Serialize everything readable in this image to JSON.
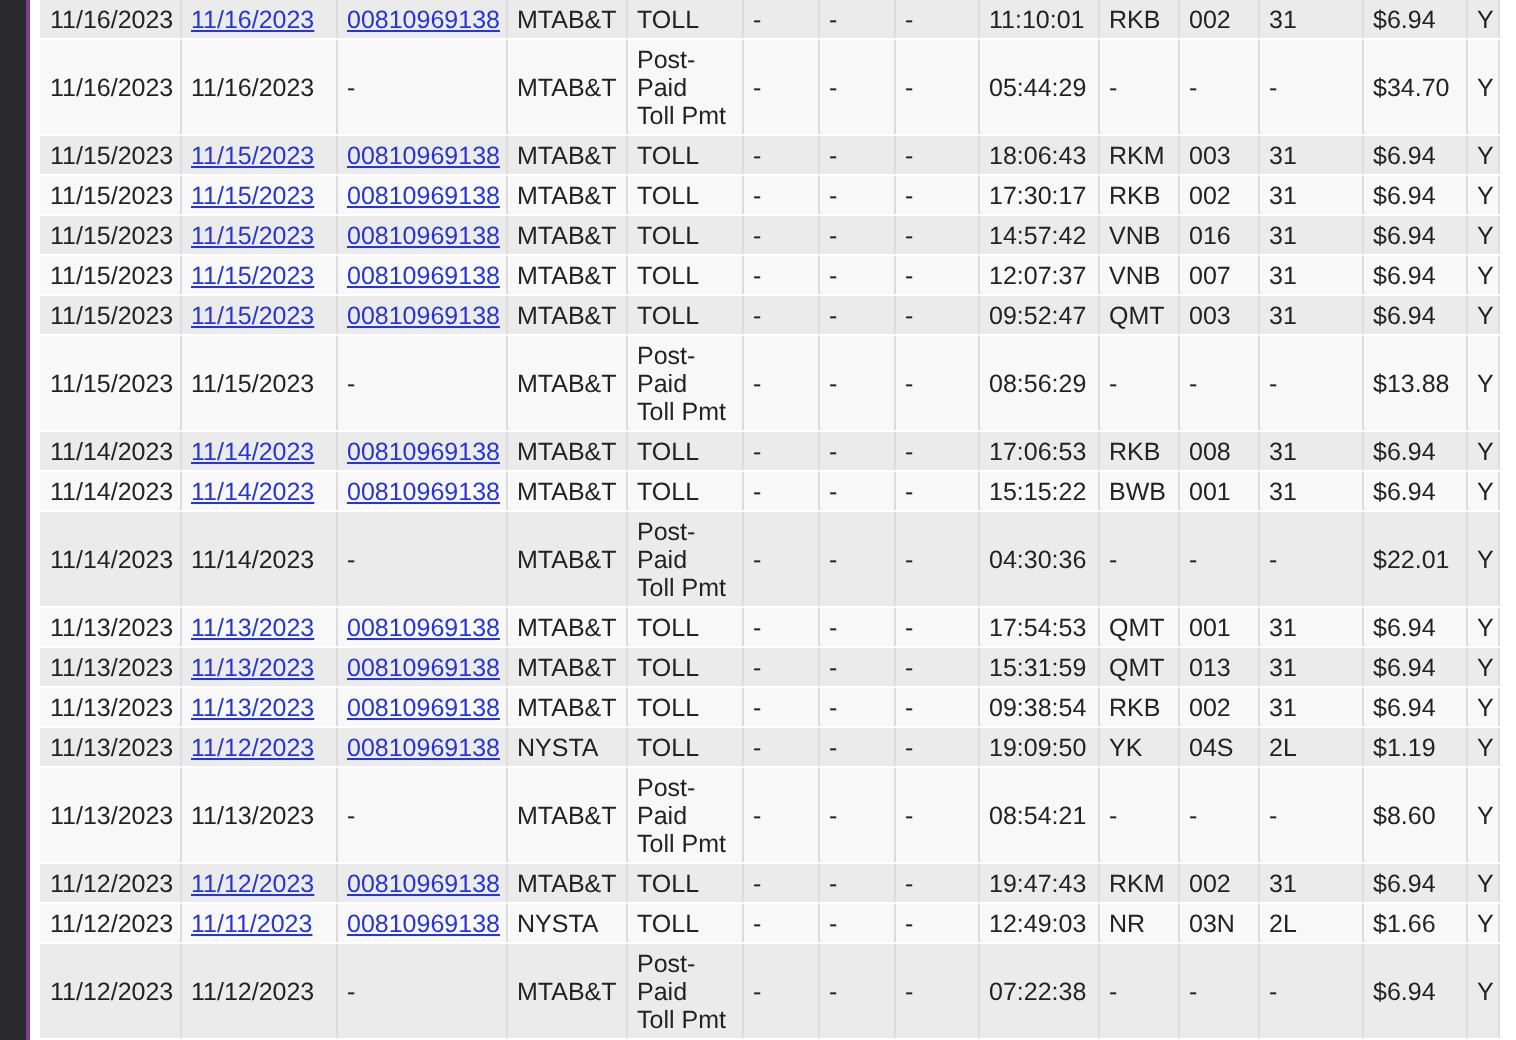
{
  "table": {
    "rows": [
      {
        "kind": "toll",
        "cells": [
          "11/16/2023",
          "11/16/2023",
          "00810969138",
          "MTAB&T",
          "TOLL",
          "-",
          "-",
          "-",
          "11:10:01",
          "RKB",
          "002",
          "31",
          "$6.94",
          "Y"
        ]
      },
      {
        "kind": "payment",
        "cells": [
          "11/16/2023",
          "11/16/2023",
          "-",
          "MTAB&T",
          "Post-Paid Toll Pmt",
          "-",
          "-",
          "-",
          "05:44:29",
          "-",
          "-",
          "-",
          "$34.70",
          "Y"
        ]
      },
      {
        "kind": "toll",
        "cells": [
          "11/15/2023",
          "11/15/2023",
          "00810969138",
          "MTAB&T",
          "TOLL",
          "-",
          "-",
          "-",
          "18:06:43",
          "RKM",
          "003",
          "31",
          "$6.94",
          "Y"
        ]
      },
      {
        "kind": "toll",
        "cells": [
          "11/15/2023",
          "11/15/2023",
          "00810969138",
          "MTAB&T",
          "TOLL",
          "-",
          "-",
          "-",
          "17:30:17",
          "RKB",
          "002",
          "31",
          "$6.94",
          "Y"
        ]
      },
      {
        "kind": "toll",
        "cells": [
          "11/15/2023",
          "11/15/2023",
          "00810969138",
          "MTAB&T",
          "TOLL",
          "-",
          "-",
          "-",
          "14:57:42",
          "VNB",
          "016",
          "31",
          "$6.94",
          "Y"
        ]
      },
      {
        "kind": "toll",
        "cells": [
          "11/15/2023",
          "11/15/2023",
          "00810969138",
          "MTAB&T",
          "TOLL",
          "-",
          "-",
          "-",
          "12:07:37",
          "VNB",
          "007",
          "31",
          "$6.94",
          "Y"
        ]
      },
      {
        "kind": "toll",
        "cells": [
          "11/15/2023",
          "11/15/2023",
          "00810969138",
          "MTAB&T",
          "TOLL",
          "-",
          "-",
          "-",
          "09:52:47",
          "QMT",
          "003",
          "31",
          "$6.94",
          "Y"
        ]
      },
      {
        "kind": "payment",
        "cells": [
          "11/15/2023",
          "11/15/2023",
          "-",
          "MTAB&T",
          "Post-Paid Toll Pmt",
          "-",
          "-",
          "-",
          "08:56:29",
          "-",
          "-",
          "-",
          "$13.88",
          "Y"
        ]
      },
      {
        "kind": "toll",
        "cells": [
          "11/14/2023",
          "11/14/2023",
          "00810969138",
          "MTAB&T",
          "TOLL",
          "-",
          "-",
          "-",
          "17:06:53",
          "RKB",
          "008",
          "31",
          "$6.94",
          "Y"
        ]
      },
      {
        "kind": "toll",
        "cells": [
          "11/14/2023",
          "11/14/2023",
          "00810969138",
          "MTAB&T",
          "TOLL",
          "-",
          "-",
          "-",
          "15:15:22",
          "BWB",
          "001",
          "31",
          "$6.94",
          "Y"
        ]
      },
      {
        "kind": "payment",
        "cells": [
          "11/14/2023",
          "11/14/2023",
          "-",
          "MTAB&T",
          "Post-Paid Toll Pmt",
          "-",
          "-",
          "-",
          "04:30:36",
          "-",
          "-",
          "-",
          "$22.01",
          "Y"
        ]
      },
      {
        "kind": "toll",
        "cells": [
          "11/13/2023",
          "11/13/2023",
          "00810969138",
          "MTAB&T",
          "TOLL",
          "-",
          "-",
          "-",
          "17:54:53",
          "QMT",
          "001",
          "31",
          "$6.94",
          "Y"
        ]
      },
      {
        "kind": "toll",
        "cells": [
          "11/13/2023",
          "11/13/2023",
          "00810969138",
          "MTAB&T",
          "TOLL",
          "-",
          "-",
          "-",
          "15:31:59",
          "QMT",
          "013",
          "31",
          "$6.94",
          "Y"
        ]
      },
      {
        "kind": "toll",
        "cells": [
          "11/13/2023",
          "11/13/2023",
          "00810969138",
          "MTAB&T",
          "TOLL",
          "-",
          "-",
          "-",
          "09:38:54",
          "RKB",
          "002",
          "31",
          "$6.94",
          "Y"
        ]
      },
      {
        "kind": "toll",
        "cells": [
          "11/13/2023",
          "11/12/2023",
          "00810969138",
          "NYSTA",
          "TOLL",
          "-",
          "-",
          "-",
          "19:09:50",
          "YK",
          "04S",
          "2L",
          "$1.19",
          "Y"
        ]
      },
      {
        "kind": "payment",
        "cells": [
          "11/13/2023",
          "11/13/2023",
          "-",
          "MTAB&T",
          "Post-Paid Toll Pmt",
          "-",
          "-",
          "-",
          "08:54:21",
          "-",
          "-",
          "-",
          "$8.60",
          "Y"
        ]
      },
      {
        "kind": "toll",
        "cells": [
          "11/12/2023",
          "11/12/2023",
          "00810969138",
          "MTAB&T",
          "TOLL",
          "-",
          "-",
          "-",
          "19:47:43",
          "RKM",
          "002",
          "31",
          "$6.94",
          "Y"
        ]
      },
      {
        "kind": "toll",
        "cells": [
          "11/12/2023",
          "11/11/2023",
          "00810969138",
          "NYSTA",
          "TOLL",
          "-",
          "-",
          "-",
          "12:49:03",
          "NR",
          "03N",
          "2L",
          "$1.66",
          "Y"
        ]
      },
      {
        "kind": "payment",
        "cells": [
          "11/12/2023",
          "11/12/2023",
          "-",
          "MTAB&T",
          "Post-Paid Toll Pmt",
          "-",
          "-",
          "-",
          "07:22:38",
          "-",
          "-",
          "-",
          "$6.94",
          "Y"
        ]
      }
    ]
  }
}
